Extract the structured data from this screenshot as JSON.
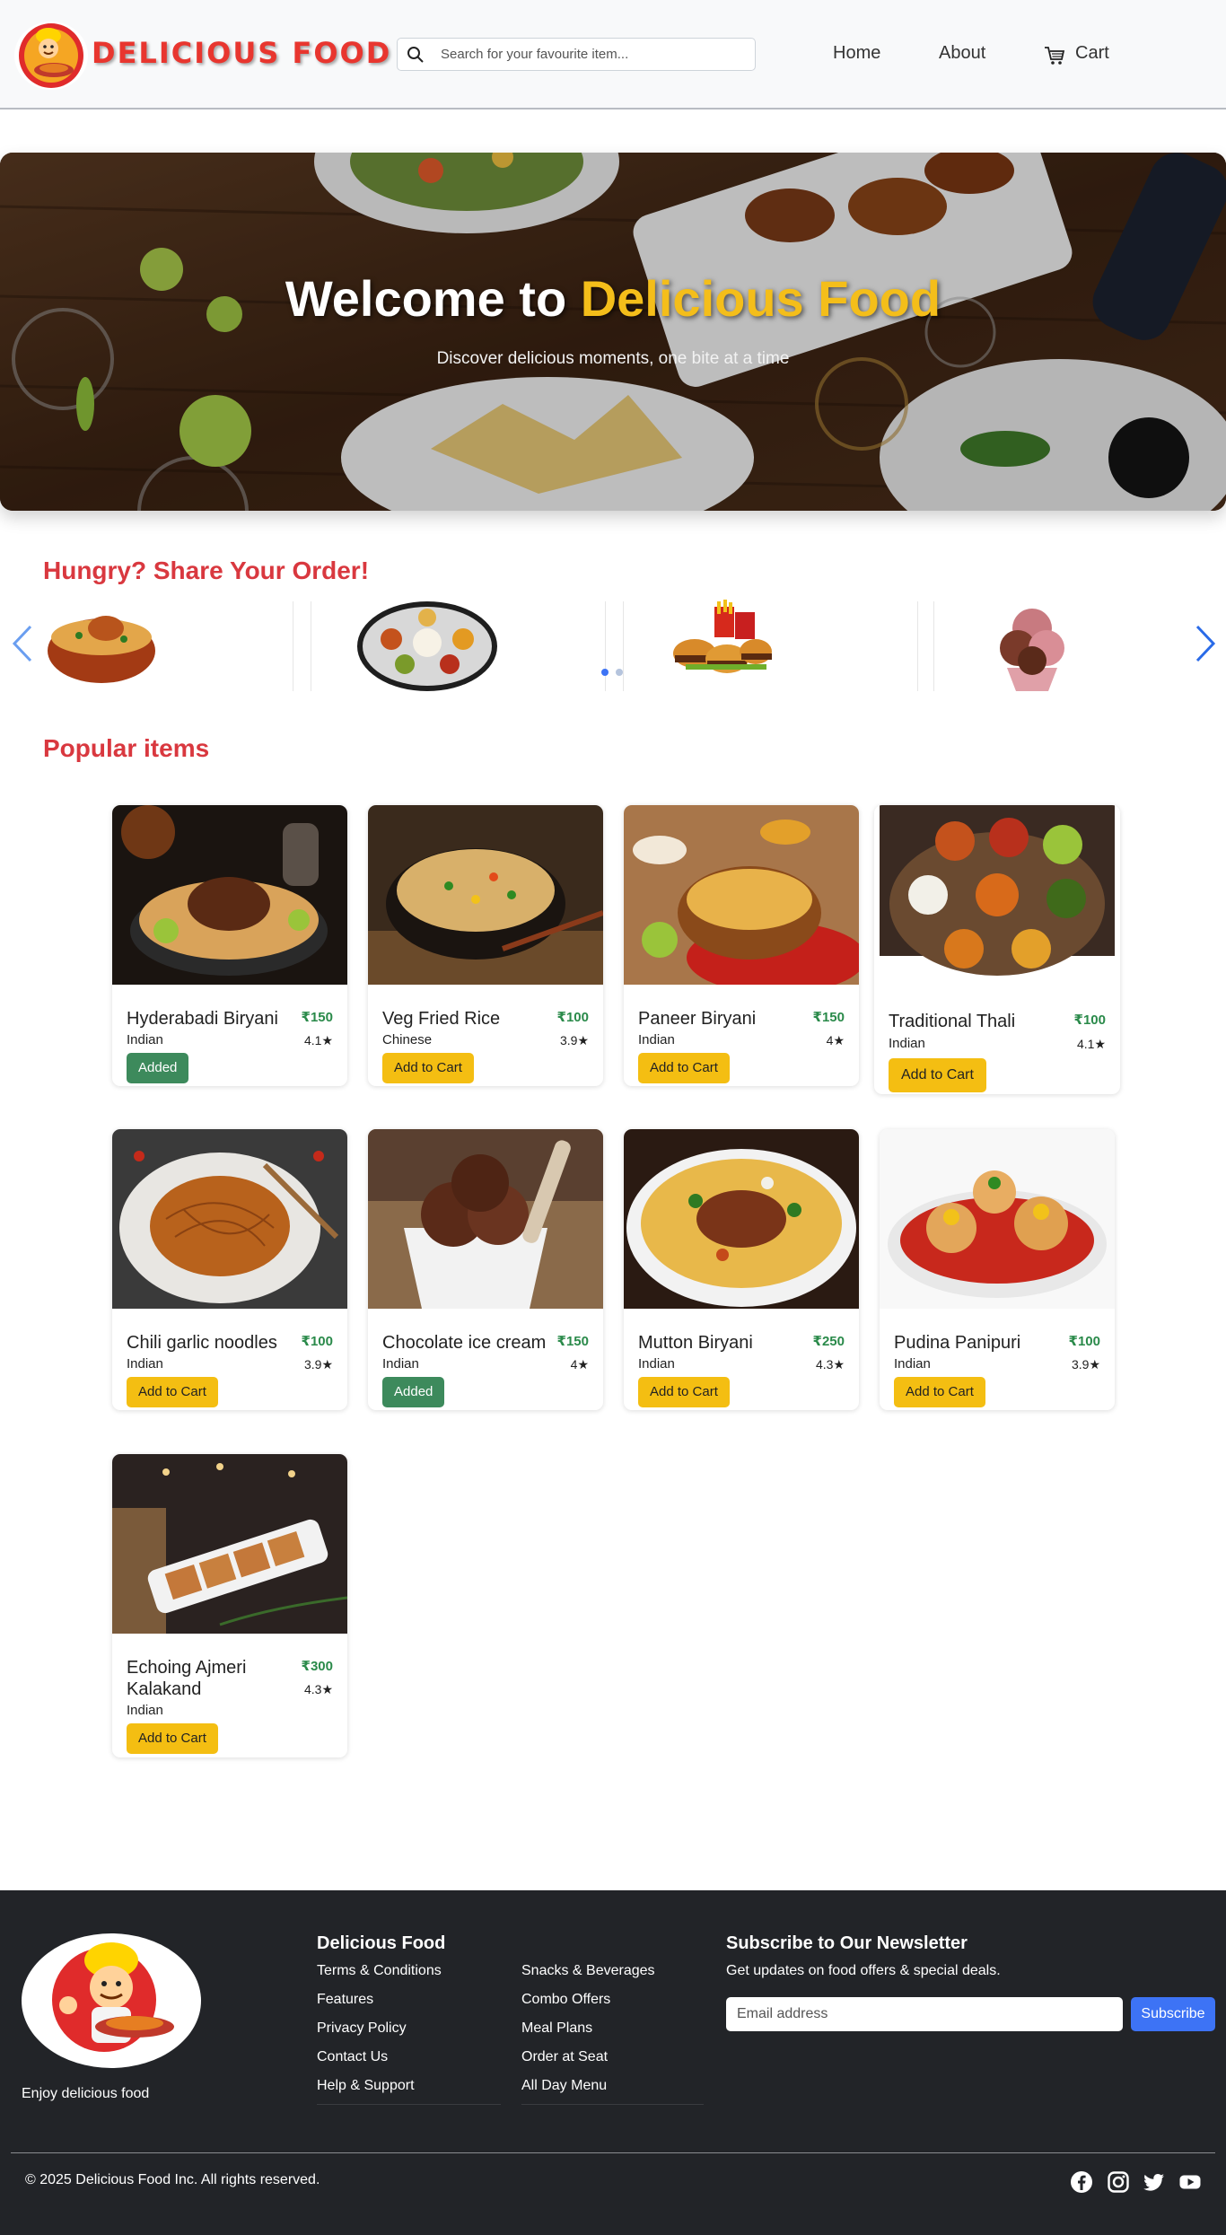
{
  "header": {
    "brand": "DELICIOUS FOOD",
    "search_placeholder": "Search for your favourite item...",
    "nav": {
      "home": "Home",
      "about": "About",
      "cart": "Cart"
    }
  },
  "hero": {
    "title_prefix": "Welcome to ",
    "title_accent": "Delicious Food",
    "subtitle": "Discover delicious moments, one bite at a time"
  },
  "share_order": {
    "title": "Hungry? Share Your Order!",
    "carousel_items": [
      "chicken-biryani-bowl",
      "thali-platter",
      "burgers-and-fries",
      "ice-cream-scoops"
    ],
    "active_slide": 1,
    "slide_count": 2
  },
  "popular": {
    "title": "Popular items",
    "items": [
      {
        "name": "Hyderabadi Biryani",
        "price": "₹150",
        "category": "Indian",
        "rating": "4.1★",
        "button": "Added",
        "added": true
      },
      {
        "name": "Veg Fried Rice",
        "price": "₹100",
        "category": "Chinese",
        "rating": "3.9★",
        "button": "Add to Cart",
        "added": false
      },
      {
        "name": "Paneer Biryani",
        "price": "₹150",
        "category": "Indian",
        "rating": "4★",
        "button": "Add to Cart",
        "added": false
      },
      {
        "name": "Traditional Thali",
        "price": "₹100",
        "category": "Indian",
        "rating": "4.1★",
        "button": "Add to Cart",
        "added": false
      },
      {
        "name": "Chili garlic noodles",
        "price": "₹100",
        "category": "Indian",
        "rating": "3.9★",
        "button": "Add to Cart",
        "added": false
      },
      {
        "name": "Chocolate ice cream",
        "price": "₹150",
        "category": "Indian",
        "rating": "4★",
        "button": "Added",
        "added": true
      },
      {
        "name": "Mutton Biryani",
        "price": "₹250",
        "category": "Indian",
        "rating": "4.3★",
        "button": "Add to Cart",
        "added": false
      },
      {
        "name": "Pudina Panipuri",
        "price": "₹100",
        "category": "Indian",
        "rating": "3.9★",
        "button": "Add to Cart",
        "added": false
      },
      {
        "name": "Echoing Ajmeri Kalakand",
        "price": "₹300",
        "category": "Indian",
        "rating": "4.3★",
        "button": "Add to Cart",
        "added": false
      }
    ]
  },
  "footer": {
    "tagline": "Enjoy delicious food",
    "col1_title": "Delicious Food",
    "col1_links": [
      "Terms & Conditions",
      "Features",
      "Privacy Policy",
      "Contact Us",
      "Help & Support"
    ],
    "col2_links": [
      "Snacks & Beverages",
      "Combo Offers",
      "Meal Plans",
      "Order at Seat",
      "All Day Menu"
    ],
    "newsletter_title": "Subscribe to Our Newsletter",
    "newsletter_text": "Get updates on food offers & special deals.",
    "email_placeholder": "Email address",
    "subscribe_label": "Subscribe",
    "copyright": "© 2025 Delicious Food Inc. All rights reserved.",
    "social_icons": [
      "facebook-icon",
      "instagram-icon",
      "twitter-icon",
      "youtube-icon"
    ]
  },
  "colors": {
    "brand_red": "#e8362f",
    "section_red": "#d9383f",
    "accent_yellow": "#f4be1a",
    "added_green": "#3d8a5c",
    "price_green": "#2a8a4a",
    "subscribe_blue": "#3d73f5",
    "footer_bg": "#222428"
  }
}
